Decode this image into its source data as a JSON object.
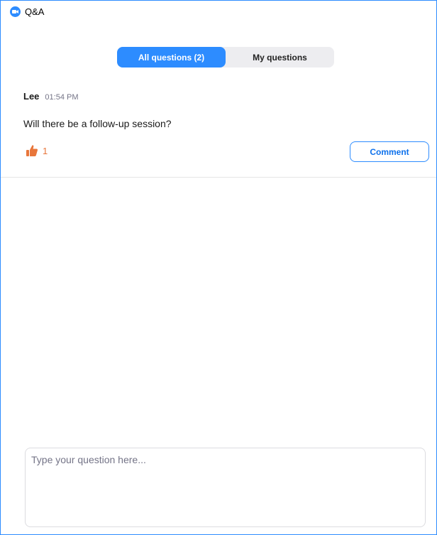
{
  "window": {
    "title": "Q&A",
    "app_icon": "zoom-camera-icon"
  },
  "tabs": [
    {
      "label": "All questions (2)",
      "active": true
    },
    {
      "label": "My questions",
      "active": false
    }
  ],
  "question": {
    "author": "Lee",
    "time": "01:54 PM",
    "text": "Will there be a follow-up session?",
    "like_icon": "thumbs-up-icon",
    "like_count": "1",
    "comment_label": "Comment"
  },
  "compose": {
    "placeholder": "Type your question here...",
    "value": ""
  },
  "colors": {
    "accent": "#2d8cff",
    "like": "#e8763b",
    "tab_bg": "#ededf0"
  }
}
